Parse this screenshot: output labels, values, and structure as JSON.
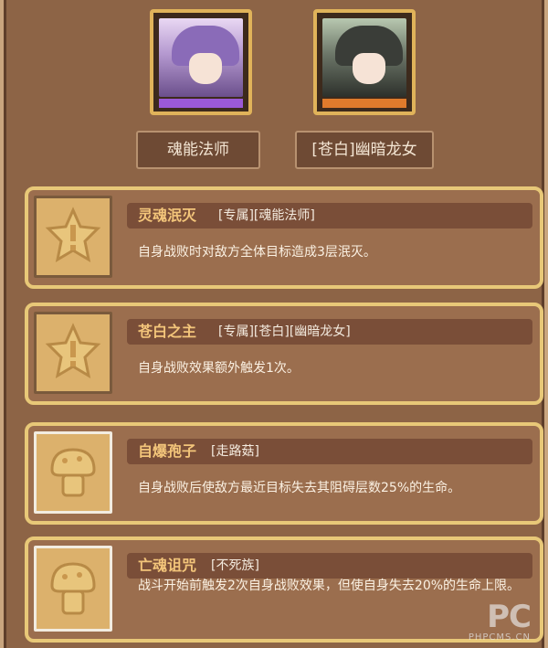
{
  "characters": [
    {
      "name": "魂能法师",
      "portrait_icon": "mage-portrait",
      "accent": "#9b59d6"
    },
    {
      "name": "[苍白]幽暗龙女",
      "portrait_icon": "dragon-girl-portrait",
      "accent": "#e07b2c"
    }
  ],
  "skills": [
    {
      "name": "灵魂泯灭",
      "tags": "[专属][魂能法师]",
      "description": "自身战败时对敌方全体目标造成3层泯灭。",
      "icon": "star-icon"
    },
    {
      "name": "苍白之主",
      "tags": "[专属][苍白][幽暗龙女]",
      "description": "自身战败效果额外触发1次。",
      "icon": "star-icon"
    },
    {
      "name": "自爆孢子",
      "tags": "[走路菇]",
      "description": "自身战败后使敌方最近目标失去其阻碍层数25%的生命。",
      "icon": "mushroom-icon"
    },
    {
      "name": "亡魂诅咒",
      "tags": "[不死族]",
      "description": "战斗开始前触发2次自身战败效果，但使自身失去20%的生命上限。",
      "icon": "mushroom-icon"
    }
  ],
  "watermark": {
    "logo": "PC",
    "text": "PHPCMS.CN"
  },
  "colors": {
    "background": "#8d6446",
    "card_border": "#e8c878",
    "title_text": "#f3c57a"
  }
}
